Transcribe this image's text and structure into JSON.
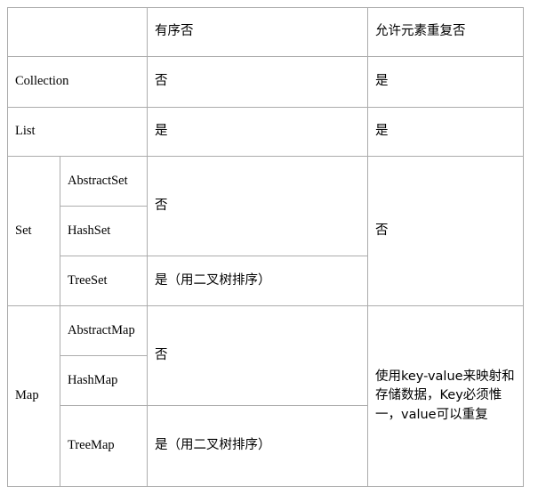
{
  "table": {
    "columns": [
      {
        "key": "group",
        "header": ""
      },
      {
        "key": "impl",
        "header": ""
      },
      {
        "key": "ordered",
        "header": "有序否"
      },
      {
        "key": "duplicates",
        "header": "允许元素重复否"
      }
    ],
    "header": {
      "corner_left": "",
      "corner_mid": "",
      "ordered": "有序否",
      "duplicates": "允许元素重复否"
    },
    "rows": [
      {
        "name": "collection-row",
        "group": "Collection",
        "impl": "",
        "ordered": "否",
        "duplicates": "是"
      },
      {
        "name": "list-row",
        "group": "List",
        "impl": "",
        "ordered": "是",
        "duplicates": "是"
      }
    ],
    "set_group": {
      "group": "Set",
      "duplicates": "否",
      "sub_rows": [
        {
          "impl": "AbstractSet",
          "ordered": "否"
        },
        {
          "impl": "HashSet",
          "ordered": ""
        },
        {
          "impl": "TreeSet",
          "ordered": "是（用二叉树排序）"
        }
      ],
      "ordered_merged": "否",
      "ordered_tree": "是（用二叉树排序）"
    },
    "map_group": {
      "group": "Map",
      "duplicates": "使用key-value来映射和存储数据，Key必须惟一，value可以重复",
      "sub_rows": [
        {
          "impl": "AbstractMap",
          "ordered": "否"
        },
        {
          "impl": "HashMap",
          "ordered": ""
        },
        {
          "impl": "TreeMap",
          "ordered": "是（用二叉树排序）"
        }
      ],
      "ordered_merged": "否",
      "ordered_tree": "是（用二叉树排序）"
    }
  },
  "style": {
    "border_color": "#acacac",
    "text_color": "#000000",
    "background": "#ffffff"
  }
}
